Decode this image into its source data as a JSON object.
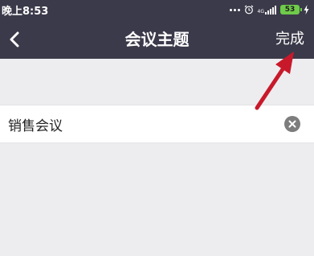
{
  "status_bar": {
    "time": "晚上8:53",
    "network": "4G",
    "battery_level": "53"
  },
  "nav": {
    "title": "会议主题",
    "done_label": "完成"
  },
  "topic_input": {
    "value": "销售会议"
  },
  "icons": {
    "back": "chevron-left-icon",
    "clear": "clear-icon",
    "alarm": "alarm-icon",
    "signal": "signal-icon",
    "battery": "battery-icon",
    "charging": "bolt-icon"
  },
  "colors": {
    "header_bg": "#3b3a4a",
    "page_bg": "#ededf0",
    "annotation_arrow": "#c8192b",
    "battery": "#6fcb4a"
  }
}
